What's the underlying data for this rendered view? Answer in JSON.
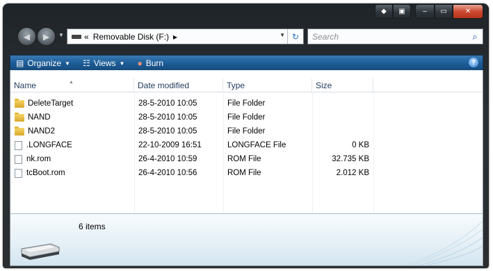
{
  "window": {
    "caption_extra": [
      "◆",
      "▣"
    ],
    "caption_min": "‒",
    "caption_max": "▭",
    "caption_close": "✕"
  },
  "address": {
    "chevron": "«",
    "location": "Removable Disk (F:)",
    "arrow": "▸",
    "search_placeholder": "Search"
  },
  "toolbar": {
    "organize": "Organize",
    "views": "Views",
    "burn": "Burn"
  },
  "columns": [
    "Name",
    "Date modified",
    "Type",
    "Size"
  ],
  "files": [
    {
      "name": "DeleteTarget",
      "date": "28-5-2010 10:05",
      "type": "File Folder",
      "size": "",
      "icon": "folder-icon"
    },
    {
      "name": "NAND",
      "date": "28-5-2010 10:05",
      "type": "File Folder",
      "size": "",
      "icon": "folder-icon"
    },
    {
      "name": "NAND2",
      "date": "28-5-2010 10:05",
      "type": "File Folder",
      "size": "",
      "icon": "folder-icon"
    },
    {
      "name": ".LONGFACE",
      "date": "22-10-2009 16:51",
      "type": "LONGFACE File",
      "size": "0 KB",
      "icon": "file-icon"
    },
    {
      "name": "nk.rom",
      "date": "26-4-2010 10:59",
      "type": "ROM File",
      "size": "32.735 KB",
      "icon": "file-icon"
    },
    {
      "name": "tcBoot.rom",
      "date": "26-4-2010 10:56",
      "type": "ROM File",
      "size": "2.012 KB",
      "icon": "file-icon"
    }
  ],
  "details": {
    "item_count": "6 items"
  },
  "colors": {
    "accent": "#1d5d97",
    "frame": "#2b3034",
    "header_text": "#1e395b"
  }
}
